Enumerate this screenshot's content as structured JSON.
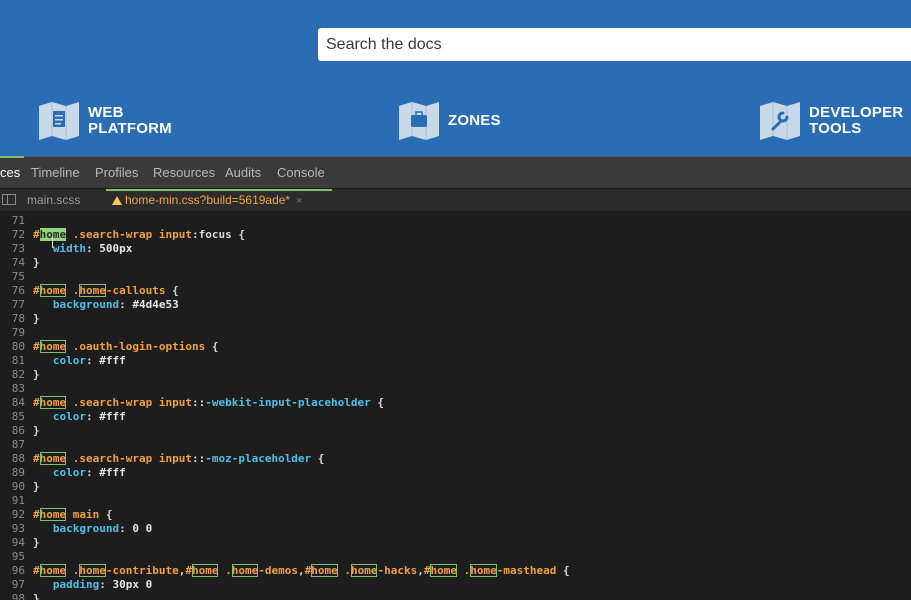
{
  "site": {
    "search_placeholder": "Search the docs",
    "zones": [
      {
        "label": "WEB\nPLATFORM",
        "icon": "document-map-icon"
      },
      {
        "label": "ZONES",
        "icon": "briefcase-map-icon"
      },
      {
        "label": "DEVELOPER\nTOOLS",
        "icon": "wrench-map-icon"
      }
    ],
    "colors": {
      "header_bg": "#2a6db5",
      "icon_fill": "#c9d9ea"
    }
  },
  "devtools": {
    "panel_tabs": [
      "ces",
      "Timeline",
      "Profiles",
      "Resources",
      "Audits",
      "Console"
    ],
    "active_panel": "ces",
    "file_tabs": [
      {
        "label": "main.scss",
        "active": false
      },
      {
        "label": "home-min.css?build=5619ade*",
        "active": true,
        "warning": true,
        "close": "×"
      }
    ]
  },
  "editor": {
    "lines": [
      {
        "n": "71",
        "code": []
      },
      {
        "n": "72",
        "code": [
          [
            "sel",
            "#"
          ],
          [
            "hlf",
            "home"
          ],
          [
            "pl",
            " "
          ],
          [
            "sel",
            ".search-wrap input"
          ],
          [
            "pl",
            ":focus {"
          ]
        ]
      },
      {
        "n": "73",
        "code": [
          [
            "pl",
            "   "
          ],
          [
            "prop",
            "width"
          ],
          [
            "pl",
            ": "
          ],
          [
            "val",
            "500px"
          ]
        ]
      },
      {
        "n": "74",
        "code": [
          [
            "pl",
            "}"
          ]
        ]
      },
      {
        "n": "75",
        "code": []
      },
      {
        "n": "76",
        "code": [
          [
            "sel",
            "#"
          ],
          [
            "hl",
            "home"
          ],
          [
            "pl",
            " "
          ],
          [
            "sel",
            "."
          ],
          [
            "hl",
            "home"
          ],
          [
            "sel",
            "-callouts"
          ],
          [
            "pl",
            " {"
          ]
        ]
      },
      {
        "n": "77",
        "code": [
          [
            "pl",
            "   "
          ],
          [
            "prop",
            "background"
          ],
          [
            "pl",
            ": "
          ],
          [
            "val",
            "#4d4e53"
          ]
        ]
      },
      {
        "n": "78",
        "code": [
          [
            "pl",
            "}"
          ]
        ]
      },
      {
        "n": "79",
        "code": []
      },
      {
        "n": "80",
        "code": [
          [
            "sel",
            "#"
          ],
          [
            "hl",
            "home"
          ],
          [
            "pl",
            " "
          ],
          [
            "sel",
            ".oauth-login-options"
          ],
          [
            "pl",
            " {"
          ]
        ]
      },
      {
        "n": "81",
        "code": [
          [
            "pl",
            "   "
          ],
          [
            "prop",
            "color"
          ],
          [
            "pl",
            ": "
          ],
          [
            "val",
            "#fff"
          ]
        ]
      },
      {
        "n": "82",
        "code": [
          [
            "pl",
            "}"
          ]
        ]
      },
      {
        "n": "83",
        "code": []
      },
      {
        "n": "84",
        "code": [
          [
            "sel",
            "#"
          ],
          [
            "hl",
            "home"
          ],
          [
            "pl",
            " "
          ],
          [
            "sel",
            ".search-wrap input"
          ],
          [
            "pl",
            "::"
          ],
          [
            "pseudo",
            "-webkit-input-placeholder"
          ],
          [
            "pl",
            " {"
          ]
        ]
      },
      {
        "n": "85",
        "code": [
          [
            "pl",
            "   "
          ],
          [
            "prop",
            "color"
          ],
          [
            "pl",
            ": "
          ],
          [
            "val",
            "#fff"
          ]
        ]
      },
      {
        "n": "86",
        "code": [
          [
            "pl",
            "}"
          ]
        ]
      },
      {
        "n": "87",
        "code": []
      },
      {
        "n": "88",
        "code": [
          [
            "sel",
            "#"
          ],
          [
            "hl",
            "home"
          ],
          [
            "pl",
            " "
          ],
          [
            "sel",
            ".search-wrap input"
          ],
          [
            "pl",
            "::"
          ],
          [
            "pseudo",
            "-moz-placeholder"
          ],
          [
            "pl",
            " {"
          ]
        ]
      },
      {
        "n": "89",
        "code": [
          [
            "pl",
            "   "
          ],
          [
            "prop",
            "color"
          ],
          [
            "pl",
            ": "
          ],
          [
            "val",
            "#fff"
          ]
        ]
      },
      {
        "n": "90",
        "code": [
          [
            "pl",
            "}"
          ]
        ]
      },
      {
        "n": "91",
        "code": []
      },
      {
        "n": "92",
        "code": [
          [
            "sel",
            "#"
          ],
          [
            "hl",
            "home"
          ],
          [
            "pl",
            " "
          ],
          [
            "sel",
            "main"
          ],
          [
            "pl",
            " {"
          ]
        ]
      },
      {
        "n": "93",
        "code": [
          [
            "pl",
            "   "
          ],
          [
            "prop",
            "background"
          ],
          [
            "pl",
            ": "
          ],
          [
            "val",
            "0 0"
          ]
        ]
      },
      {
        "n": "94",
        "code": [
          [
            "pl",
            "}"
          ]
        ]
      },
      {
        "n": "95",
        "code": []
      },
      {
        "n": "96",
        "code": [
          [
            "sel",
            "#"
          ],
          [
            "hl",
            "home"
          ],
          [
            "pl",
            " "
          ],
          [
            "sel",
            "."
          ],
          [
            "hl",
            "home"
          ],
          [
            "sel",
            "-contribute"
          ],
          [
            "pl",
            ","
          ],
          [
            "sel",
            "#"
          ],
          [
            "hl",
            "home"
          ],
          [
            "pl",
            " "
          ],
          [
            "sel",
            "."
          ],
          [
            "hl",
            "home"
          ],
          [
            "sel",
            "-demos"
          ],
          [
            "pl",
            ","
          ],
          [
            "sel",
            "#"
          ],
          [
            "hl",
            "home"
          ],
          [
            "pl",
            " "
          ],
          [
            "sel",
            "."
          ],
          [
            "hl",
            "home"
          ],
          [
            "sel",
            "-hacks"
          ],
          [
            "pl",
            ","
          ],
          [
            "sel",
            "#"
          ],
          [
            "hl",
            "home"
          ],
          [
            "pl",
            " "
          ],
          [
            "sel",
            "."
          ],
          [
            "hl",
            "home"
          ],
          [
            "sel",
            "-masthead"
          ],
          [
            "pl",
            " {"
          ]
        ]
      },
      {
        "n": "97",
        "code": [
          [
            "pl",
            "   "
          ],
          [
            "prop",
            "padding"
          ],
          [
            "pl",
            ": "
          ],
          [
            "val",
            "30px 0"
          ]
        ]
      },
      {
        "n": "98",
        "code": [
          [
            "pl",
            "}"
          ]
        ]
      }
    ]
  }
}
